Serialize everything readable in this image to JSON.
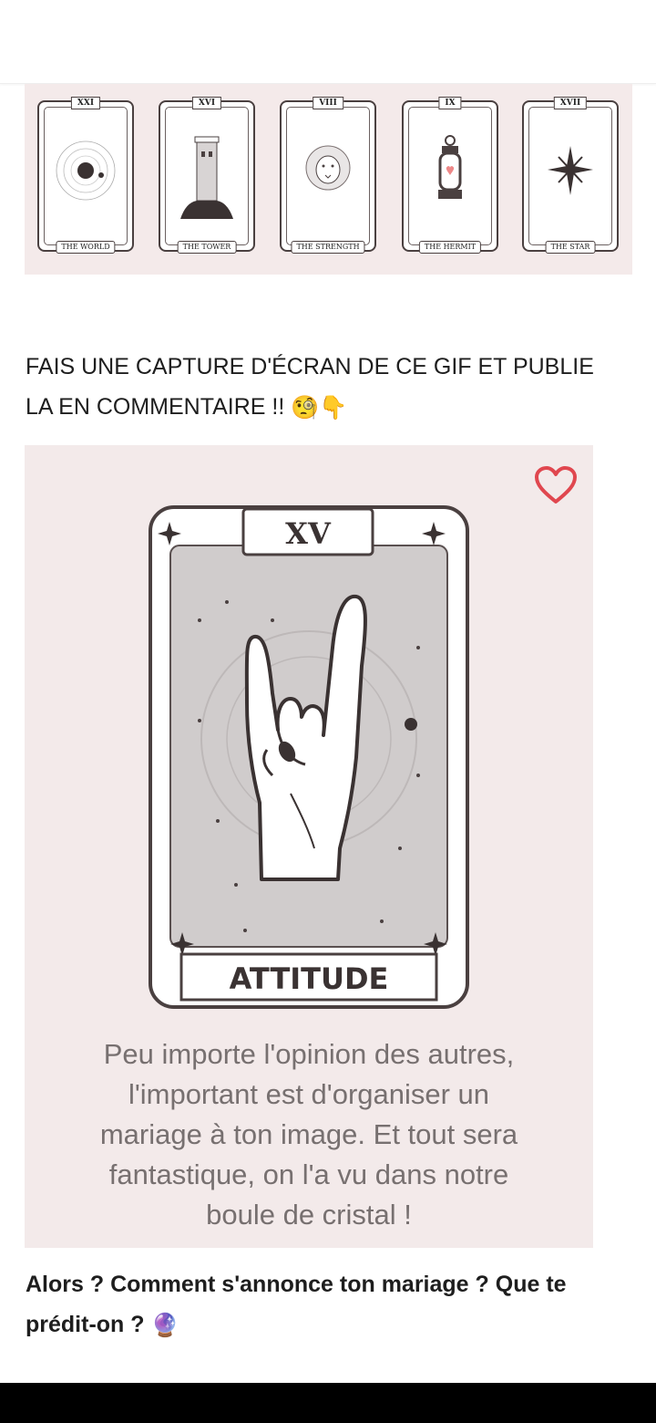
{
  "tarot_strip": {
    "cards": [
      {
        "number": "XXI",
        "name": "THE WORLD",
        "icon": "planet-icon"
      },
      {
        "number": "XVI",
        "name": "THE TOWER",
        "icon": "tower-icon"
      },
      {
        "number": "VIII",
        "name": "THE STRENGTH",
        "icon": "lion-icon"
      },
      {
        "number": "IX",
        "name": "THE HERMIT",
        "icon": "lantern-icon"
      },
      {
        "number": "XVII",
        "name": "THE STAR",
        "icon": "star-icon"
      }
    ]
  },
  "post": {
    "heading": "FAIS UNE CAPTURE D'ÉCRAN DE CE GIF ET PUBLIE LA EN COMMENTAIRE !!",
    "heading_emojis": "🧐👇",
    "gif": {
      "card_number": "XV",
      "card_title": "ATTITUDE",
      "card_icon": "rock-hand-icon",
      "favorite_icon": "heart-icon",
      "message_lines": [
        "Peu importe l'opinion des autres,",
        "l'important est d'organiser un",
        "mariage à ton image. Et tout sera",
        "fantastique, on l'a vu dans notre",
        "boule de cristal !"
      ]
    },
    "question": "Alors ? Comment s'annonce ton mariage ? Que te prédit-on ?",
    "question_emoji": "🔮"
  },
  "colors": {
    "panel_bg": "#f3eaea",
    "card_outline": "#4a4040",
    "card_fill": "#cfcccc",
    "heart": "#e0474f",
    "message_text": "#777070"
  }
}
